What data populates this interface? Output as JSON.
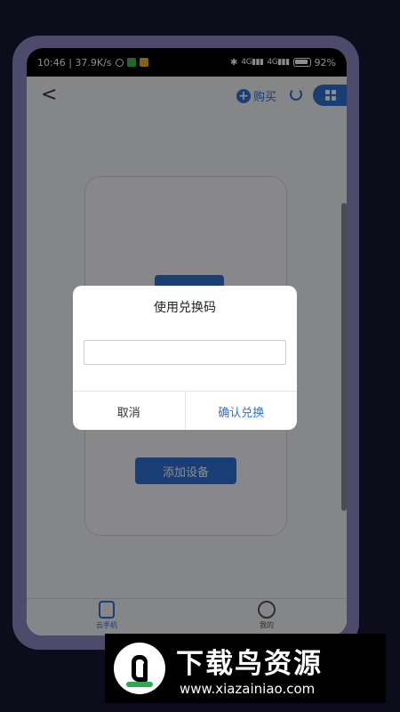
{
  "status_bar": {
    "time_speed": "10:46 | 37.9K/s",
    "network": "4G",
    "battery_text": "92%",
    "battery_level": 0.92
  },
  "header": {
    "back": "<",
    "buy_label": "购买",
    "plus": "+"
  },
  "device_card": {
    "add_device_label": "添加设备"
  },
  "tabs": [
    {
      "label": "云手机",
      "active": true
    },
    {
      "label": "我的",
      "active": false
    }
  ],
  "dialog": {
    "title": "使用兑换码",
    "input_value": "",
    "input_placeholder": "",
    "cancel_label": "取消",
    "confirm_label": "确认兑换"
  },
  "watermark": {
    "title": "下载鸟资源",
    "url": "www.xiazainiao.com"
  },
  "colors": {
    "accent": "#2f6fd6",
    "background": "#0d0c1a",
    "frame": "#4e4a6b"
  }
}
